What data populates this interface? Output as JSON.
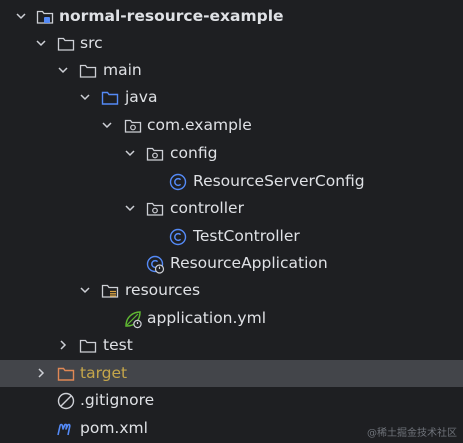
{
  "tree": {
    "root": "normal-resource-example",
    "src": "src",
    "main": "main",
    "java": "java",
    "package": "com.example",
    "config": "config",
    "config_class": "ResourceServerConfig",
    "controller": "controller",
    "controller_class": "TestController",
    "app_class": "ResourceApplication",
    "resources": "resources",
    "app_yml": "application.yml",
    "test": "test",
    "target": "target",
    "gitignore": ".gitignore",
    "pom": "pom.xml"
  },
  "watermark": "@稀土掘金技术社区",
  "colors": {
    "background": "#1e1f22",
    "selection": "#43454a",
    "text": "#dfe1e5",
    "excluded_text": "#c5a64a",
    "class_icon": "#548af7",
    "source_folder": "#548af7",
    "spring_icon": "#5fb832",
    "maven_icon": "#548af7"
  }
}
